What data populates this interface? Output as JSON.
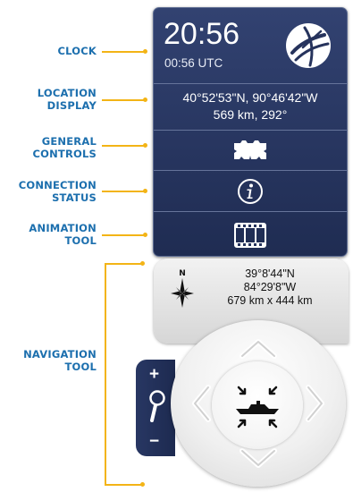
{
  "callouts": {
    "clock": [
      "CLOCK"
    ],
    "location": [
      "LOCATION",
      "DISPLAY"
    ],
    "general": [
      "GENERAL",
      "CONTROLS"
    ],
    "connection": [
      "CONNECTION",
      "STATUS"
    ],
    "animation": [
      "ANIMATION",
      "TOOL"
    ],
    "navigation": [
      "NAVIGATION",
      "TOOL"
    ]
  },
  "clock": {
    "time": "20:56",
    "utc": "00:56 UTC",
    "icon": "globe-icon"
  },
  "location": {
    "coords": "40°52'53\"N, 90°46'42\"W",
    "distance": "569 km, 292°"
  },
  "controls": {
    "general_icon": "gear-strip-icon",
    "connection_icon": "info-icon",
    "animation_icon": "film-icon"
  },
  "navigation": {
    "compass_label": "N",
    "lat": "39°8'44\"N",
    "lon": "84°29'8\"W",
    "extent": "679 km x 444 km",
    "zoom_in": "+",
    "zoom_out": "−",
    "zoom_icon": "magnifier-icon",
    "center_icon": "recenter-ship-icon"
  },
  "colors": {
    "panel": "#26335c",
    "callout_text": "#1c6fae",
    "leader_line": "#f3b416"
  }
}
